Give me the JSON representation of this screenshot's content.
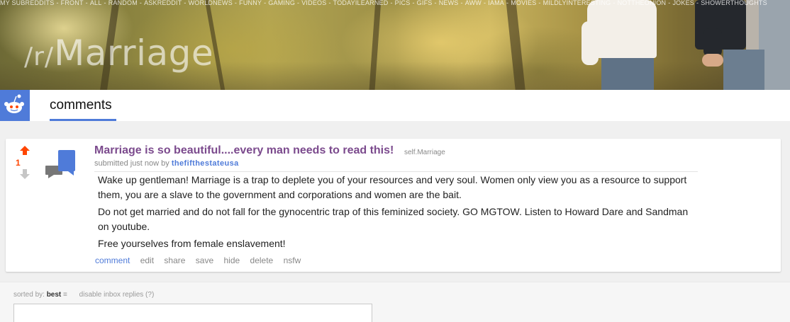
{
  "topnav": {
    "items": [
      "MY SUBREDDITS",
      "FRONT",
      "ALL",
      "RANDOM",
      "ASKREDDIT",
      "WORLDNEWS",
      "FUNNY",
      "GAMING",
      "VIDEOS",
      "TODAYILEARNED",
      "PICS",
      "GIFS",
      "NEWS",
      "AWW",
      "IAMA",
      "MOVIES",
      "MILDLYINTERESTING",
      "NOTTHEONION",
      "JOKES",
      "SHOWERTHOUGHTS"
    ],
    "separator": "-"
  },
  "subreddit": {
    "prefix": "/r/",
    "name": "Marriage"
  },
  "header": {
    "logo_icon": "snoo-reddit-icon",
    "tab_label": "comments",
    "accent_color": "#4f7bd9"
  },
  "post": {
    "score": "1",
    "title": "Marriage is so beautiful....every man needs to read this!",
    "domain": "self.Marriage",
    "tagline_prefix": "submitted just now by",
    "author": "thefifthestateusa",
    "body": [
      "Wake up gentleman! Marriage is a trap to deplete you of your resources and very soul. Women only view you as a resource to support them, you are a slave to the government and corporations and women are the bait.",
      "Do not get married and do not fall for the gynocentric trap of this feminized society. GO MGTOW. Listen to Howard Dare and Sandman on youtube.",
      "Free yourselves from female enslavement!"
    ],
    "buttons": [
      "comment",
      "edit",
      "share",
      "save",
      "hide",
      "delete",
      "nsfw"
    ],
    "title_color": "#7b4a8d",
    "upvote_color": "#ff4500"
  },
  "comments_area": {
    "sorted_by_label": "sorted by:",
    "sort_value": "best",
    "sort_icon": "≡",
    "inbox_toggle": "disable inbox replies (?)"
  }
}
